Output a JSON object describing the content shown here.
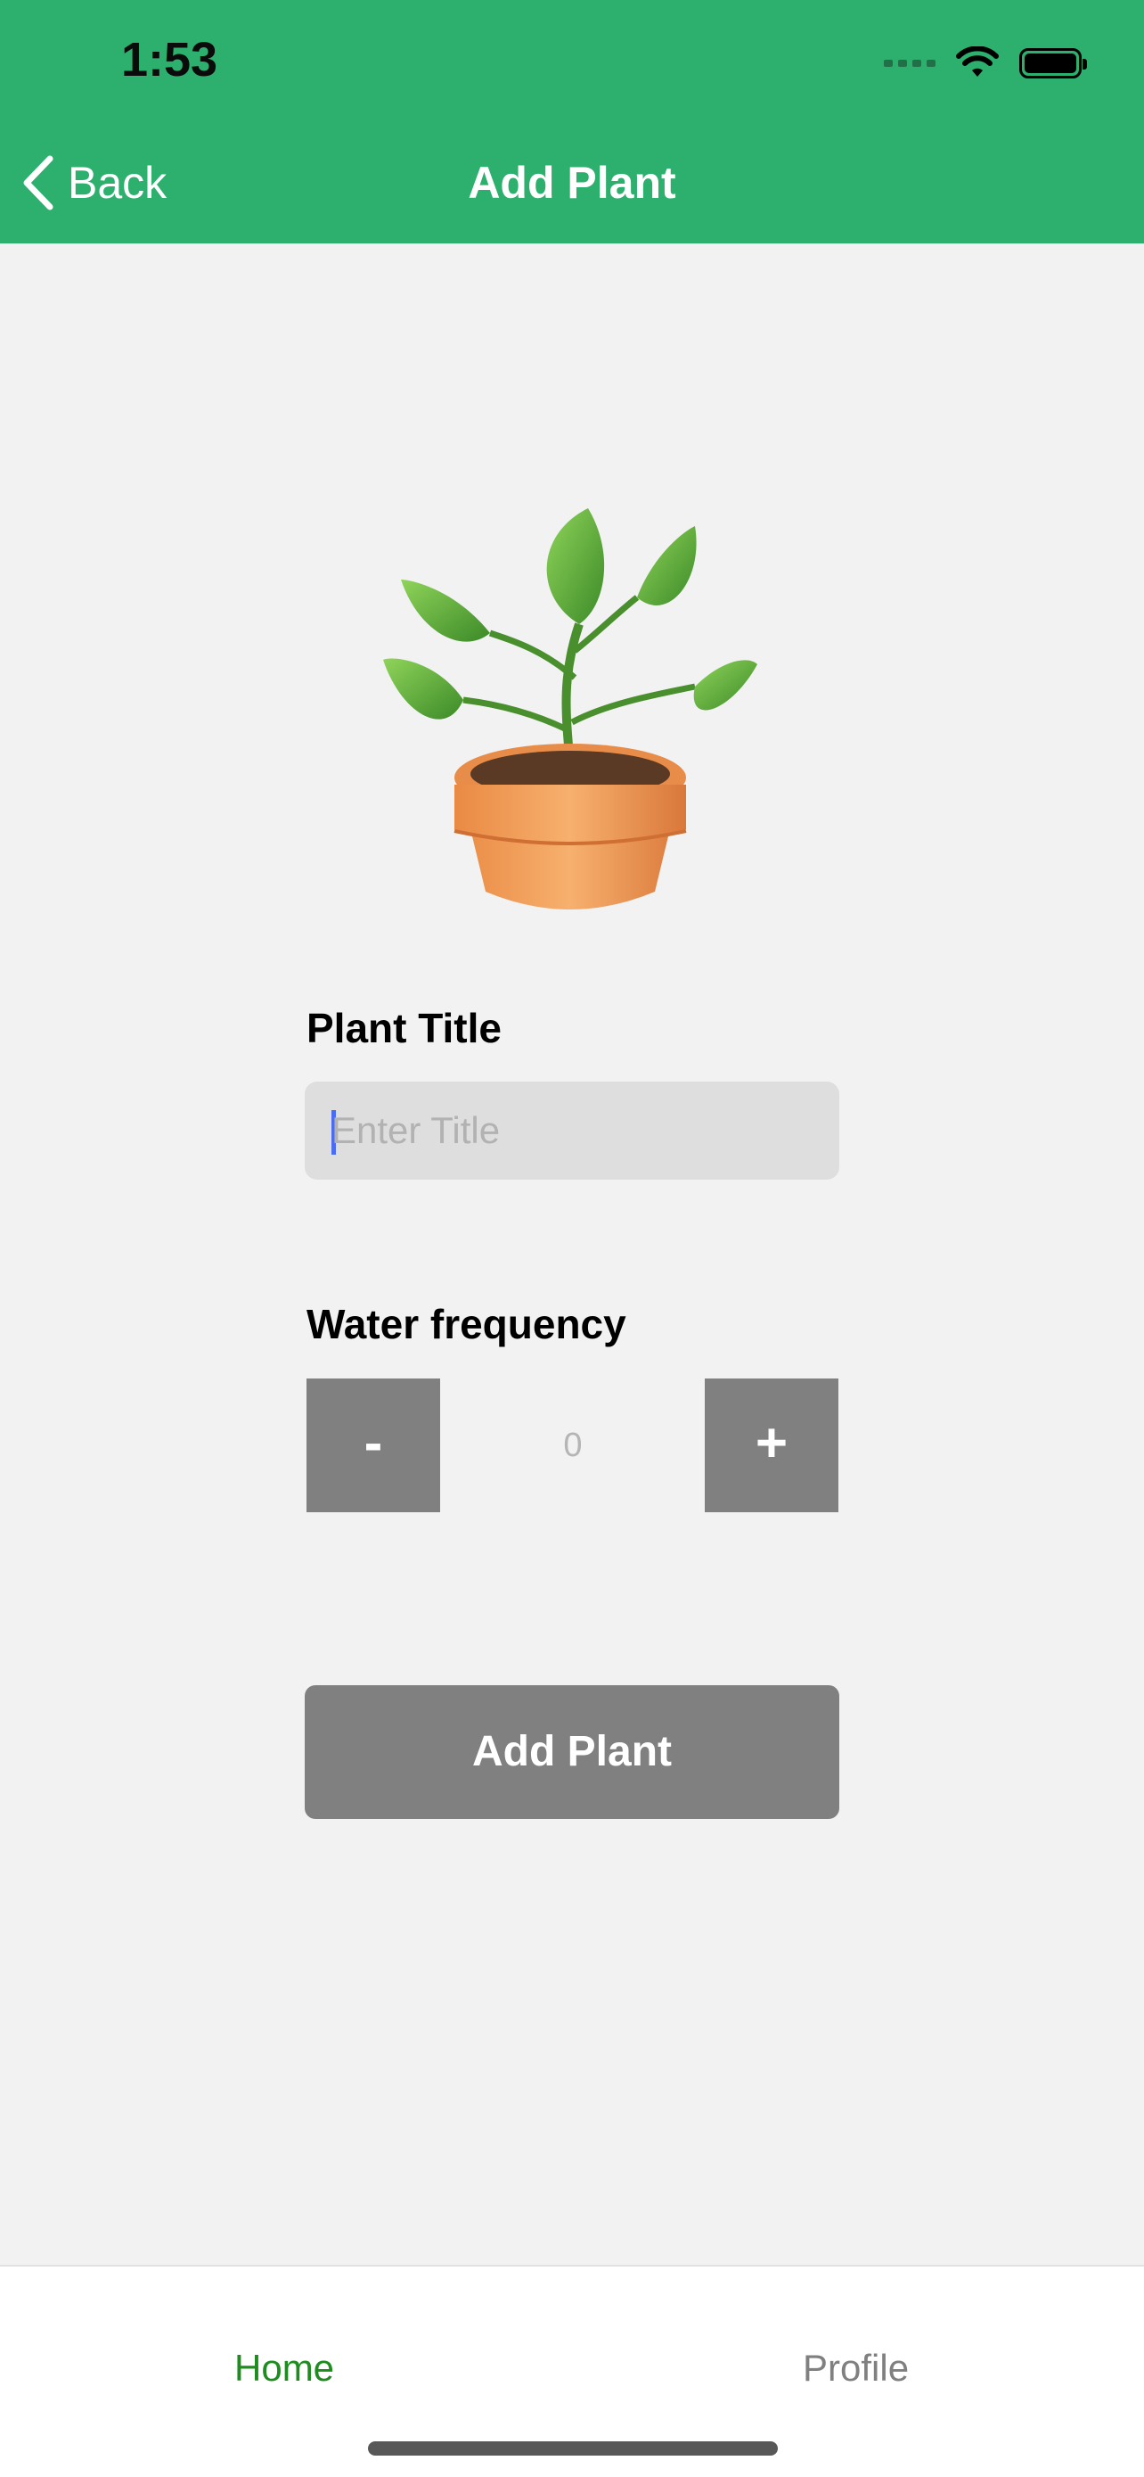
{
  "status_bar": {
    "time": "1:53"
  },
  "nav": {
    "back_label": "Back",
    "title": "Add Plant"
  },
  "form": {
    "title_label": "Plant Title",
    "title_input": {
      "value": "",
      "placeholder": "Enter Title"
    },
    "frequency_label": "Water frequency",
    "decrement_label": "-",
    "increment_label": "+",
    "frequency_value": "0",
    "submit_label": "Add Plant"
  },
  "tabbar": {
    "home_label": "Home",
    "profile_label": "Profile",
    "active": "home"
  },
  "colors": {
    "header_bg": "#2daf6e",
    "active_tab": "#1e8c1e",
    "inactive_tab": "#808080",
    "button_bg": "#808080"
  },
  "icons": [
    "chevron-left-icon",
    "potted-plant-image",
    "wifi-icon",
    "battery-icon",
    "signal-icon"
  ]
}
